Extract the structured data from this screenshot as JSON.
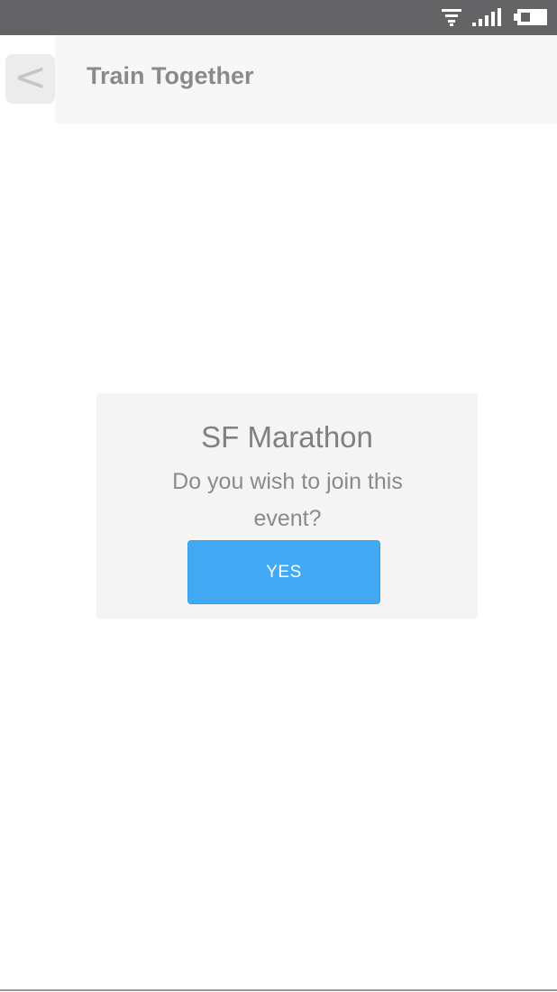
{
  "status_bar": {
    "icons": [
      "wifi-icon",
      "signal-icon",
      "battery-icon"
    ],
    "background": "#646466"
  },
  "header": {
    "back_label": "<",
    "title": "Train Together"
  },
  "dialog": {
    "title": "SF Marathon",
    "message": "Do you wish to join this event?",
    "confirm_label": "YES",
    "confirm_color": "#42a9f5"
  }
}
